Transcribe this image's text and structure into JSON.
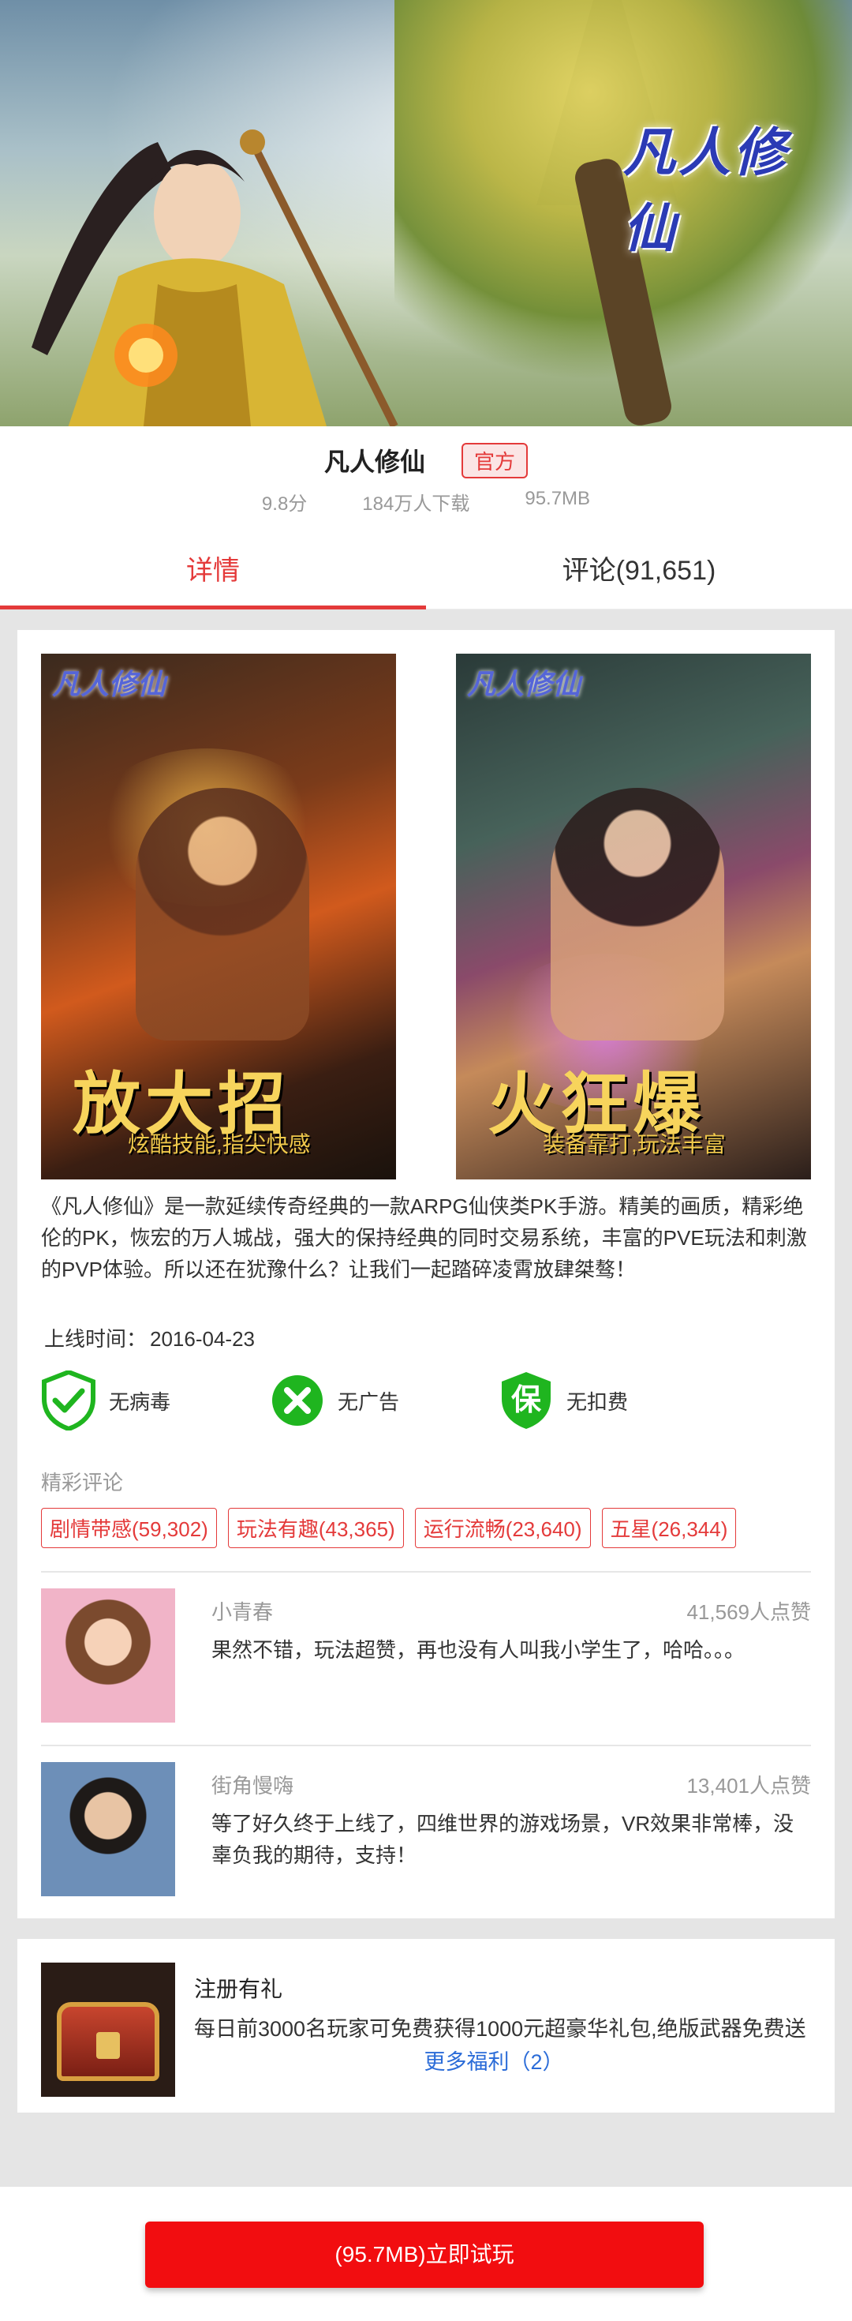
{
  "app": {
    "name": "凡人修仙",
    "badge": "官方",
    "rating": "9.8分",
    "downloads": "184万人下载",
    "size": "95.7MB",
    "logo_text": "凡人修仙"
  },
  "tabs": [
    {
      "label": "详情",
      "active": true
    },
    {
      "label": "评论(91,651)",
      "active": false
    }
  ],
  "screenshots": [
    {
      "logo": "凡人修仙",
      "big_text": "放大招",
      "sub_text": "炫酷技能,指尖快感"
    },
    {
      "logo": "凡人修仙",
      "big_text": "火狂爆",
      "sub_text": "装备靠打,玩法丰富"
    }
  ],
  "description": "《凡人修仙》是一款延续传奇经典的一款ARPG仙侠类PK手游。精美的画质，精彩绝伦的PK，恢宏的万人城战，强大的保持经典的同时交易系统，丰富的PVE玩法和刺激的PVP体验。所以还在犹豫什么？让我们一起踏碎凌霄放肆桀骜！",
  "online": {
    "label": "上线时间：",
    "date": "2016-04-23"
  },
  "features": [
    {
      "icon": "shield-check-icon",
      "label": "无病毒"
    },
    {
      "icon": "x-circle-icon",
      "label": "无广告"
    },
    {
      "icon": "shield-bao-icon",
      "label": "无扣费"
    }
  ],
  "reviews_section": {
    "label": "精彩评论",
    "tags": [
      "剧情带感(59,302)",
      "玩法有趣(43,365)",
      "运行流畅(23,640)",
      "五星(26,344)"
    ],
    "items": [
      {
        "name": "小青春",
        "likes": "41,569人点赞",
        "text": "果然不错，玩法超赞，再也没有人叫我小学生了，哈哈。。。"
      },
      {
        "name": "街角慢嗨",
        "likes": "13,401人点赞",
        "text": "等了好久终于上线了，四维世界的游戏场景，VR效果非常棒，没辜负我的期待，支持！"
      }
    ]
  },
  "gift": {
    "title": "注册有礼",
    "desc": "每日前3000名玩家可免费获得1000元超豪华礼包,绝版武器免费送",
    "more": "更多福利（2）"
  },
  "bottom": {
    "play_label": "(95.7MB)立即试玩"
  },
  "colors": {
    "accent": "#e43a3a",
    "button": "#f20d10",
    "link": "#2b6cd8",
    "check_green": "#1fb51f"
  }
}
